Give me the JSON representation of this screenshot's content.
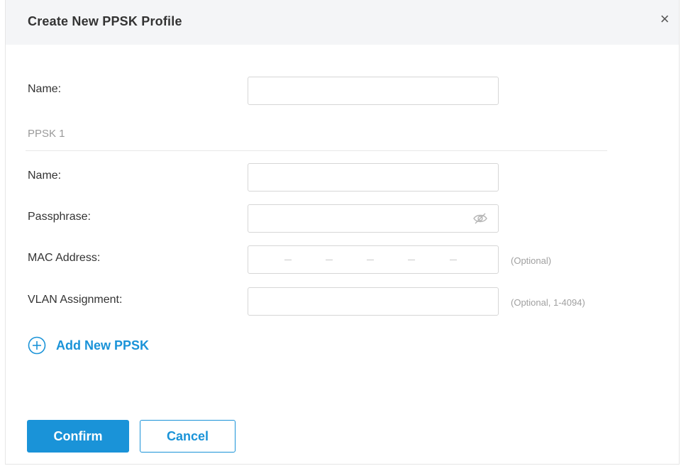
{
  "dialog": {
    "title": "Create New PPSK Profile",
    "close_symbol": "×"
  },
  "profile": {
    "name_label": "Name:",
    "name_value": ""
  },
  "ppsk": {
    "section_title": "PPSK 1",
    "name_label": "Name:",
    "name_value": "",
    "passphrase_label": "Passphrase:",
    "passphrase_value": "",
    "passphrase_icon": "eye-slash-icon",
    "mac_label": "MAC Address:",
    "mac_hint": "(Optional)",
    "vlan_label": "VLAN Assignment:",
    "vlan_hint": "(Optional, 1-4094)"
  },
  "actions": {
    "add_label": "Add New PPSK",
    "add_icon": "plus-circle-icon",
    "confirm_label": "Confirm",
    "cancel_label": "Cancel"
  },
  "colors": {
    "accent": "#1a93d8",
    "header_bg": "#f4f5f7",
    "hint": "#a0a0a0"
  }
}
